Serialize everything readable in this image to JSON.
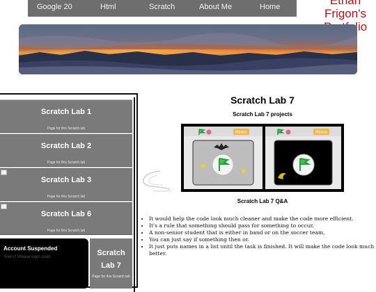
{
  "nav": {
    "items": [
      {
        "label": "Google 20"
      },
      {
        "label": "Html"
      },
      {
        "label": "Scratch"
      },
      {
        "label": "About Me"
      },
      {
        "label": "Home"
      }
    ]
  },
  "brand": {
    "line1": "Ethan",
    "line2": "Frigon's",
    "line3": "Portfolio",
    "color": "#b01515"
  },
  "sidebar": {
    "labs": [
      {
        "title": "Scratch Lab 1",
        "subtitle": "Page for this Scratch lab"
      },
      {
        "title": "Scratch Lab 2",
        "subtitle": "Page for this Scratch lab"
      },
      {
        "title": "Scratch Lab 3",
        "subtitle": "Page for this Scratch lab"
      },
      {
        "title": "Scratch Lab 6",
        "subtitle": "Page for this Scratch lab"
      }
    ],
    "suspended": {
      "title": "Account Suspended",
      "message": "Yours? Please login soon."
    },
    "lab7": {
      "title_line1": "Scratch",
      "title_line2": "Lab 7",
      "subtitle": "Page for this Scratch lab"
    }
  },
  "main": {
    "title": "Scratch Lab 7",
    "subtitle": "Scratch Lab 7 projects",
    "qa_title": "Scratch Lab 7 Q&A",
    "answers": [
      "It would help the code look much cleaner and make the code more efficient.",
      "It's a rule that something should pass for something to occur.",
      "A non-senior student that is either in band or on the soccer team.",
      "You can just say if something then or.",
      "It just puts names in a list until the task is finished. It will make the code look much better."
    ]
  },
  "projects": [
    {
      "badge": "Remix"
    },
    {
      "badge": "Remix"
    }
  ]
}
